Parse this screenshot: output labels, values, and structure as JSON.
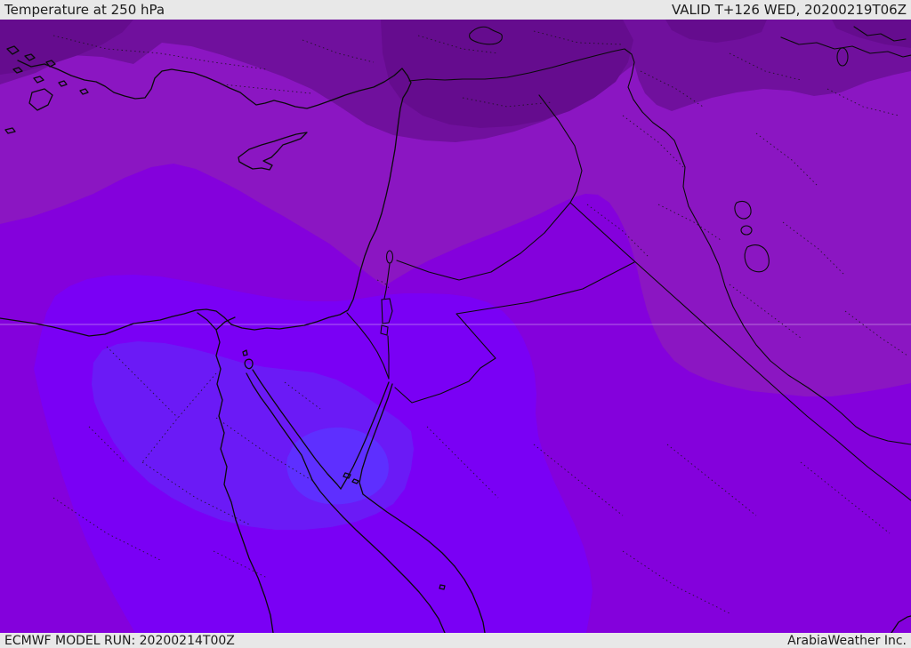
{
  "header": {
    "title": "Temperature at 250 hPa",
    "validity": "VALID T+126 WED, 20200219T06Z"
  },
  "footer": {
    "model_run": "ECMWF MODEL RUN: 20200214T00Z",
    "credit": "ArabiaWeather Inc."
  },
  "map": {
    "kind": "temperature shading map, Eastern Mediterranean / Middle East",
    "bands": [
      {
        "name": "coldest-darkest",
        "color": "#650c8e"
      },
      {
        "name": "dark",
        "color": "#70109d"
      },
      {
        "name": "mid-purple",
        "color": "#8b16c2"
      },
      {
        "name": "bright-violet",
        "color": "#8401dc"
      },
      {
        "name": "brighter-violet",
        "color": "#7a00f5"
      },
      {
        "name": "light-blue-violet",
        "color": "#6b1af6"
      },
      {
        "name": "lightest-core",
        "color": "#5e2fff"
      }
    ],
    "line_color": "#0a0a0a",
    "graticule_color": "#d9b8ef",
    "bar_background": "#e8e8e8"
  }
}
